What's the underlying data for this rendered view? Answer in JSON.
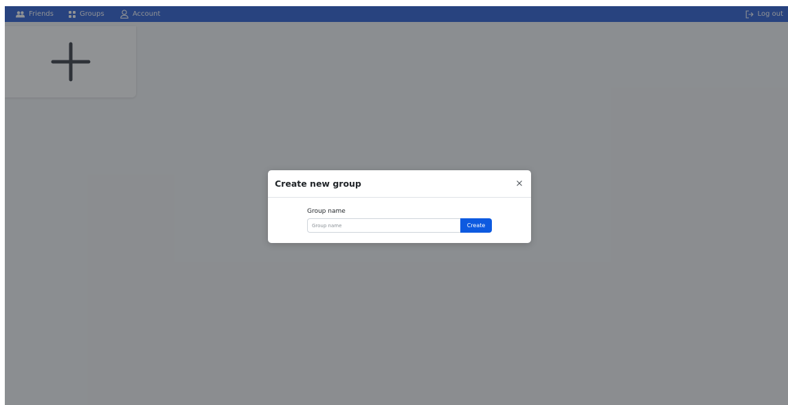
{
  "navbar": {
    "items": [
      {
        "label": "Friends",
        "icon": "people-icon"
      },
      {
        "label": "Groups",
        "icon": "grid-icon"
      },
      {
        "label": "Account",
        "icon": "person-icon"
      }
    ],
    "logout_label": "Log out",
    "logout_icon": "logout-icon"
  },
  "main": {
    "add_card_icon": "plus-icon"
  },
  "modal": {
    "title": "Create new group",
    "close_icon": "close-icon",
    "field_label": "Group name",
    "input_value": "",
    "input_placeholder": "Group name",
    "submit_label": "Create"
  },
  "colors": {
    "navbar": "#2f61d5",
    "primary_button": "#0d5ae0",
    "backdrop": "#868b92"
  }
}
